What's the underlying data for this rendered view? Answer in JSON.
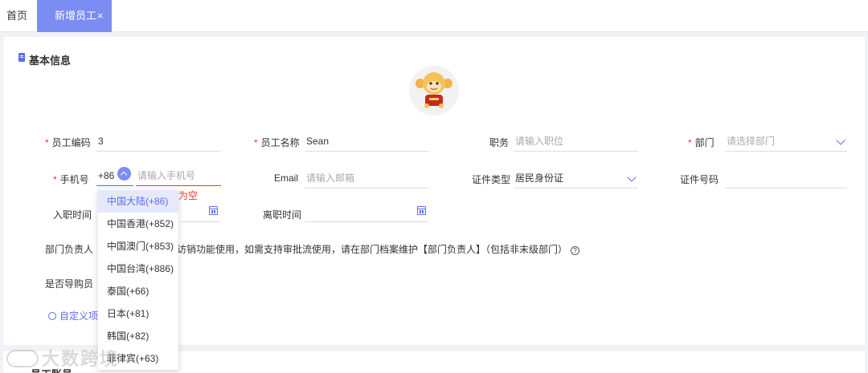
{
  "tabs": [
    {
      "label": "首页"
    },
    {
      "label": "新增员工",
      "close": "×"
    }
  ],
  "section": {
    "title": "基本信息"
  },
  "colors": {
    "accent": "#5b6cf0",
    "tab_active": "#7b8cf2",
    "error": "#e53935"
  },
  "form": {
    "employee_code": {
      "label": "员工编码",
      "required": "*",
      "value": "3"
    },
    "employee_name": {
      "label": "员工名称",
      "required": "*",
      "value": "Sean"
    },
    "position": {
      "label": "职务",
      "placeholder": "请输入职位"
    },
    "department": {
      "label": "部门",
      "required": "*",
      "placeholder": "请选择部门"
    },
    "phone": {
      "label": "手机号",
      "required": "*",
      "code": "+86",
      "placeholder": "请输入手机号",
      "error": "为空"
    },
    "email": {
      "label": "Email",
      "placeholder": "请输入邮箱"
    },
    "id_type": {
      "label": "证件类型",
      "value": "居民身份证"
    },
    "id_number": {
      "label": "证件号码"
    },
    "hire_date": {
      "label": "入职时间"
    },
    "leave_date": {
      "label": "离职时间"
    },
    "dept_head": {
      "label": "部门负责人",
      "note": "访销功能使用，如需支持审批流使用，请在部门档案维护【部门负责人】（包括非末级部门）"
    },
    "is_guide": {
      "label": "是否导购员"
    },
    "custom_item": {
      "label": "自定义项设"
    }
  },
  "country_codes": [
    {
      "label": "中国大陆(+86)"
    },
    {
      "label": "中国香港(+852)"
    },
    {
      "label": "中国澳门(+853)"
    },
    {
      "label": "中国台湾(+886)"
    },
    {
      "label": "泰国(+66)"
    },
    {
      "label": "日本(+81)"
    },
    {
      "label": "韩国(+82)"
    },
    {
      "label": "菲律宾(+63)"
    }
  ],
  "section2": {
    "title": "员工账号"
  },
  "watermark": {
    "text": "大数跨境"
  }
}
